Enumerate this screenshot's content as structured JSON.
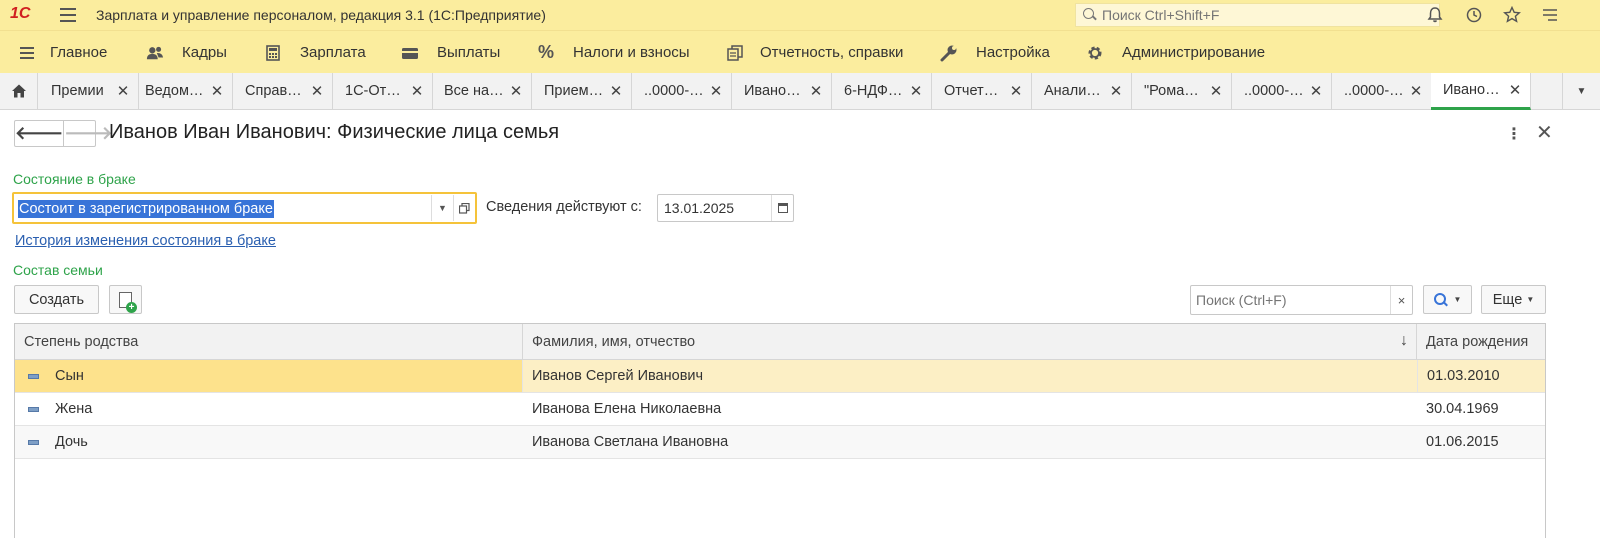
{
  "app": {
    "logo": "1С",
    "title": "Зарплата и управление персоналом, редакция 3.1  (1С:Предприятие)",
    "search_placeholder": "Поиск Ctrl+Shift+F"
  },
  "sections": [
    {
      "label": "Главное",
      "icon": "menu-lines-icon"
    },
    {
      "label": "Кадры",
      "icon": "people-icon"
    },
    {
      "label": "Зарплата",
      "icon": "calculator-icon"
    },
    {
      "label": "Выплаты",
      "icon": "wallet-icon"
    },
    {
      "label": "Налоги и взносы",
      "icon": "percent-icon"
    },
    {
      "label": "Отчетность, справки",
      "icon": "documents-icon"
    },
    {
      "label": "Настройка",
      "icon": "wrench-icon"
    },
    {
      "label": "Администрирование",
      "icon": "gear-icon"
    }
  ],
  "tabs": [
    {
      "label": "Премии"
    },
    {
      "label": "Ведом…"
    },
    {
      "label": "Справ…"
    },
    {
      "label": "1С-От…"
    },
    {
      "label": "Все на…"
    },
    {
      "label": "Прием…"
    },
    {
      "label": "..0000-…"
    },
    {
      "label": "Ивано…"
    },
    {
      "label": "6-НДФ…"
    },
    {
      "label": "Отчет…"
    },
    {
      "label": "Анали…"
    },
    {
      "label": "\"Рома…"
    },
    {
      "label": "..0000-…"
    },
    {
      "label": "..0000-…"
    },
    {
      "label": "Ивано…",
      "active": true
    }
  ],
  "form": {
    "title": "Иванов Иван Иванович: Физические лица семья",
    "marital_label": "Состояние в браке",
    "marital_value": "Состоит в зарегистрированном браке",
    "effective_label": "Сведения действуют с:",
    "effective_date": "13.01.2025",
    "history_link": "История изменения состояния в браке",
    "family_label": "Состав семьи",
    "create_button": "Создать",
    "list_search_placeholder": "Поиск (Ctrl+F)",
    "clear_symbol": "×",
    "more_button": "Еще"
  },
  "table": {
    "columns": [
      "Степень родства",
      "Фамилия, имя, отчество",
      "Дата рождения"
    ],
    "rows": [
      {
        "relation": "Сын",
        "name": "Иванов Сергей Иванович",
        "birth": "01.03.2010"
      },
      {
        "relation": "Жена",
        "name": "Иванова Елена Николаевна",
        "birth": "30.04.1969"
      },
      {
        "relation": "Дочь",
        "name": "Иванова Светлана Ивановна",
        "birth": "01.06.2015"
      }
    ]
  },
  "colors": {
    "header_bg": "#fbed9e",
    "accent_green": "#2ea34a",
    "selection_blue": "#3874d8",
    "selected_row": "#fcefc5"
  }
}
